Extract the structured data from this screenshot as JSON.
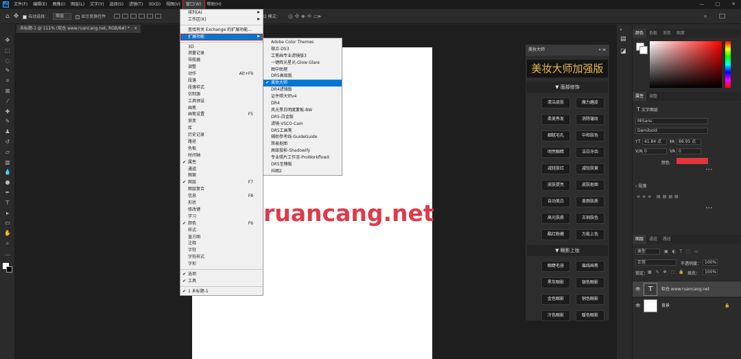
{
  "menubar": {
    "logo": "Ps",
    "items": [
      "文件(F)",
      "编辑(E)",
      "图像(I)",
      "图层(L)",
      "文字(Y)",
      "选择(S)",
      "滤镜(T)",
      "3D(D)",
      "视图(V)",
      "窗口(W)",
      "帮助(H)"
    ],
    "active_index": 9
  },
  "options": {
    "auto_select_label": "自动选择：",
    "auto_select_value": "图层",
    "show_transform_label": "显示变换控件",
    "mode_3d": "3D 模式："
  },
  "doc_tab": {
    "label": "未标题-1 @ 111% (软仓 www.ruancang.net, RGB/8#) *",
    "close": "×"
  },
  "canvas": {
    "watermark_text": "ruancang.net"
  },
  "window_menu": {
    "items": [
      {
        "label": "排列(A)",
        "arrow": true
      },
      {
        "label": "工作区(K)",
        "arrow": true
      },
      {
        "sep": true
      },
      {
        "label": "查找有关 Exchange 的扩展功能..."
      },
      {
        "label": "扩展功能",
        "arrow": true,
        "highlight": true,
        "boxed": true
      },
      {
        "sep": true
      },
      {
        "label": "3D"
      },
      {
        "label": "测量记录"
      },
      {
        "label": "导航器"
      },
      {
        "label": "调整"
      },
      {
        "label": "动作",
        "shortcut": "Alt+F9"
      },
      {
        "label": "段落"
      },
      {
        "label": "段落样式"
      },
      {
        "label": "仿制源"
      },
      {
        "label": "工具预设"
      },
      {
        "label": "画笔"
      },
      {
        "label": "画笔设置",
        "shortcut": "F5"
      },
      {
        "label": "渐变"
      },
      {
        "label": "库"
      },
      {
        "label": "历史记录"
      },
      {
        "label": "路径"
      },
      {
        "label": "色板"
      },
      {
        "label": "时间轴"
      },
      {
        "label": "属性",
        "checked": true
      },
      {
        "label": "通道"
      },
      {
        "label": "图案"
      },
      {
        "label": "图层",
        "checked": true,
        "shortcut": "F7"
      },
      {
        "label": "图层复合"
      },
      {
        "label": "信息",
        "shortcut": "F8"
      },
      {
        "label": "形状"
      },
      {
        "label": "修改键"
      },
      {
        "label": "学习"
      },
      {
        "label": "颜色",
        "checked": true,
        "shortcut": "F6"
      },
      {
        "label": "样式"
      },
      {
        "label": "直方图"
      },
      {
        "label": "注释"
      },
      {
        "label": "字符"
      },
      {
        "label": "字符样式"
      },
      {
        "label": "字形"
      },
      {
        "sep": true
      },
      {
        "label": "选项",
        "checked": true
      },
      {
        "label": "工具",
        "checked": true
      },
      {
        "sep": true
      },
      {
        "label": "1 未标题-1",
        "checked": true
      }
    ]
  },
  "ext_menu": {
    "items": [
      {
        "label": "Adobe Color Themes"
      },
      {
        "label": "微点-DS3"
      },
      {
        "label": "工笔画专业滤镜版3"
      },
      {
        "label": "一键辉光星光-Glow Glare"
      },
      {
        "label": "图中助理"
      },
      {
        "label": "DR5高级版"
      },
      {
        "label": "美妆大师",
        "checked": true,
        "highlight": true
      },
      {
        "label": "DR4滤镜版"
      },
      {
        "label": "证件照大师v4"
      },
      {
        "label": "DR4"
      },
      {
        "label": "风光黑白明度蒙板-BW"
      },
      {
        "label": "DR5-白金版"
      },
      {
        "label": "滤镜-VSCO Cam"
      },
      {
        "label": "DR5工画笔"
      },
      {
        "label": "辅助参考线-GuideGuide"
      },
      {
        "label": "简易抠图"
      },
      {
        "label": "高级投影-Shadowify"
      },
      {
        "label": "专业照片工作流-ProWorkflowX"
      },
      {
        "label": "DR5至臻版"
      },
      {
        "label": "抖图2"
      }
    ]
  },
  "plugin": {
    "tab": "美妆大师",
    "title": "美妆大师加强版",
    "section1": "▼ 面部修饰",
    "buttons1": [
      "清洁皮肤",
      "魔力磨皮",
      "柔美秀发",
      "消除皱纹",
      "细腻毛孔",
      "中和肤色",
      "明亮眼睛",
      "洁白牙齿",
      "减轻肤红",
      "减轻肤黄",
      "皮肤提亮",
      "皮肤抠图",
      "自动美白",
      "美颜肤质",
      "高光肤质",
      "古铜肤色",
      "酷红粉嫩",
      "万能上色"
    ],
    "section2": "▼ 眼影上妆",
    "buttons2": [
      "眼睫毛容",
      "眉线画笔",
      "黑灰眼影",
      "银色眼影",
      "金色眼影",
      "铜色眼影",
      "冷色眼影",
      "暖色眼影"
    ]
  },
  "panels": {
    "color_tabs": [
      "颜色",
      "色板",
      "渐变",
      "图案"
    ],
    "props_tabs": [
      "属性",
      "调整"
    ],
    "props_type": "文字图层",
    "font_family": "MiSans",
    "font_style": "Demibold",
    "font_size": "41.84 点",
    "leading": "66.95 点",
    "va": "0",
    "tracking": "0",
    "color_label": "颜色",
    "text_color": "#e0363c",
    "paragraph_label": "段落",
    "layers_tabs": [
      "图层",
      "通道",
      "路径"
    ],
    "kind": "类型",
    "blend": "正常",
    "opacity_label": "不透明度：",
    "opacity": "100%",
    "lock_label": "锁定：",
    "fill_label": "填充：",
    "fill": "100%",
    "layers": [
      {
        "name": "软仓 www.ruancang.net",
        "type": "text"
      },
      {
        "name": "背景",
        "type": "bg"
      }
    ]
  }
}
